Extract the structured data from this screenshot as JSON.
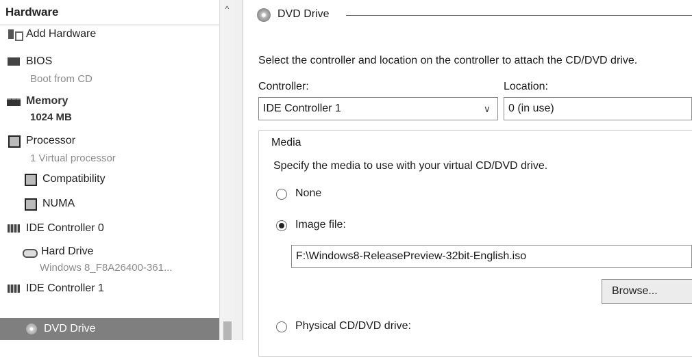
{
  "left_pane": {
    "header": "Hardware",
    "scroll_up_glyph": "^",
    "items": [
      {
        "label": "Add Hardware",
        "icon": "add-hardware-icon"
      },
      {
        "label": "BIOS",
        "sub": "Boot from CD",
        "icon": "bios-icon"
      },
      {
        "label": "Memory",
        "sub": "1024 MB",
        "icon": "memory-icon"
      },
      {
        "label": "Processor",
        "sub": "1 Virtual processor",
        "icon": "processor-icon"
      },
      {
        "label": "Compatibility",
        "icon": "processor-icon"
      },
      {
        "label": "NUMA",
        "icon": "processor-icon"
      },
      {
        "label": "IDE Controller 0",
        "icon": "ide-controller-icon"
      },
      {
        "label": "Hard Drive",
        "sub": "Windows 8_F8A26400-361...",
        "icon": "hard-drive-icon"
      },
      {
        "label": "IDE Controller 1",
        "icon": "ide-controller-icon"
      },
      {
        "label": "DVD Drive",
        "icon": "dvd-drive-icon",
        "selected": true
      }
    ]
  },
  "right_pane": {
    "section_title": "DVD Drive",
    "description": "Select the controller and location on the controller to attach the CD/DVD drive.",
    "controller_label": "Controller:",
    "controller_value": "IDE Controller 1",
    "location_label": "Location:",
    "location_value": "0 (in use)",
    "media": {
      "title": "Media",
      "description": "Specify the media to use with your virtual CD/DVD drive.",
      "options": [
        {
          "label": "None",
          "selected": false
        },
        {
          "label": "Image file:",
          "selected": true
        },
        {
          "label": "Physical CD/DVD drive:",
          "selected": false
        }
      ],
      "image_path": "F:\\Windows8-ReleasePreview-32bit-English.iso",
      "browse_label": "Browse..."
    }
  }
}
